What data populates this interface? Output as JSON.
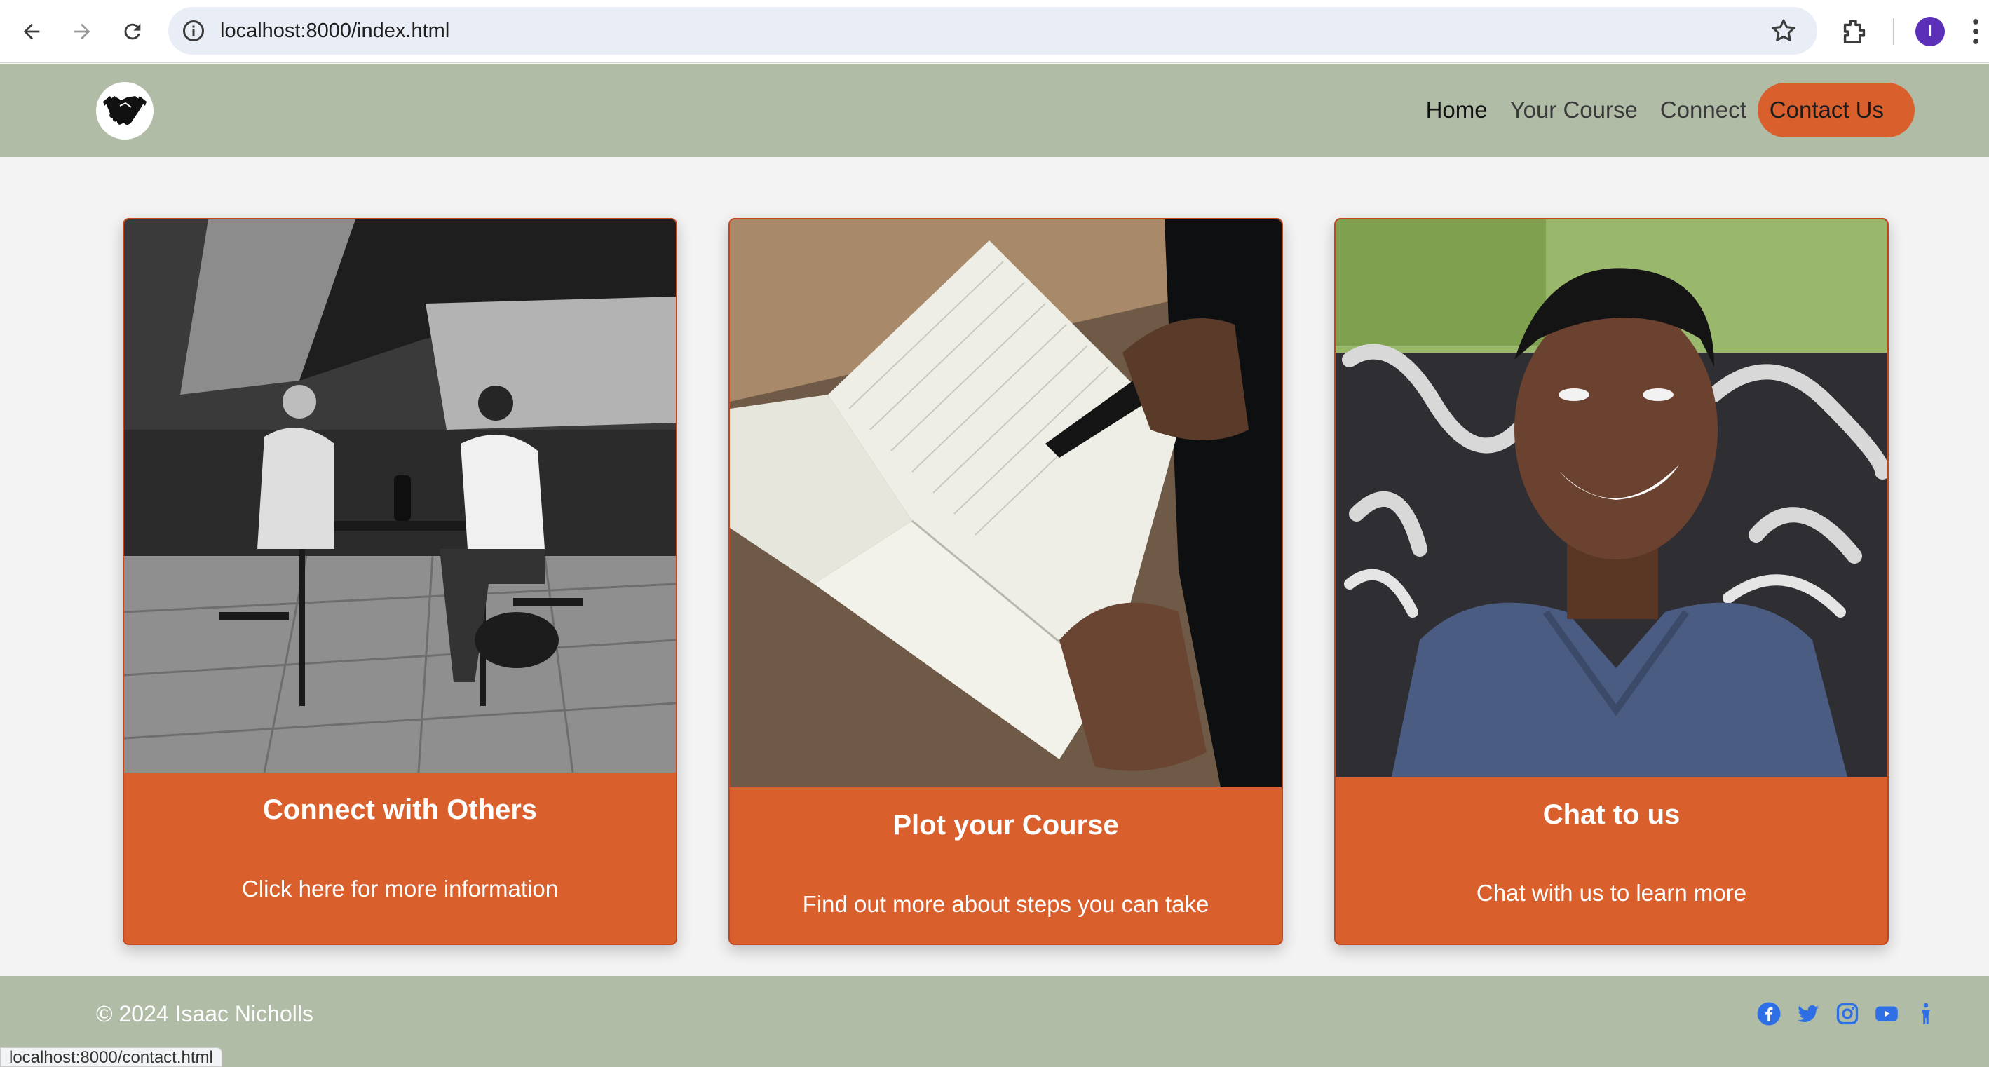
{
  "browser": {
    "url": "localhost:8000/index.html",
    "profile_initial": "I",
    "icons": [
      "back-icon",
      "forward-icon",
      "reload-icon",
      "info-icon",
      "star-icon",
      "extensions-icon",
      "kebab-menu-icon"
    ]
  },
  "header": {
    "logo": "handshake-icon",
    "nav": [
      {
        "label": "Home",
        "active": true
      },
      {
        "label": "Your Course",
        "active": false
      },
      {
        "label": "Connect",
        "active": false
      },
      {
        "label": "Contact Us",
        "active": false
      }
    ]
  },
  "cards": [
    {
      "title": "Connect with Others",
      "subtitle": "Click here for more information"
    },
    {
      "title": "Plot your Course",
      "subtitle": "Find out more about steps you can take"
    },
    {
      "title": "Chat to us",
      "subtitle": "Chat with us to learn more"
    }
  ],
  "footer": {
    "copyright": "© 2024 Isaac Nicholls",
    "social_icons": [
      "facebook-icon",
      "twitter-icon",
      "instagram-icon",
      "youtube-icon",
      "accessibility-icon"
    ]
  },
  "status_bar": {
    "url": "localhost:8000/contact.html"
  },
  "colors": {
    "header_bg": "#b0bca6",
    "accent": "#d9602c",
    "page_bg": "#f3f3f3",
    "social": "#2f6fe6"
  }
}
